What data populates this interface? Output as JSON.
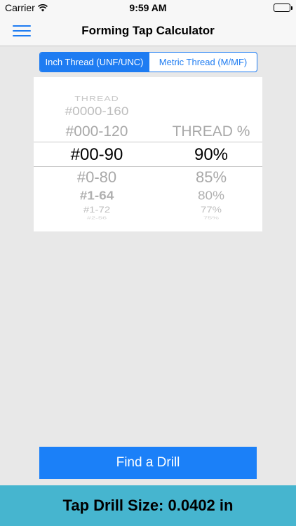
{
  "status_bar": {
    "carrier": "Carrier",
    "time": "9:59 AM"
  },
  "nav": {
    "title": "Forming Tap Calculator",
    "menu_icon": "hamburger-menu-icon"
  },
  "segments": [
    {
      "label": "Inch Thread (UNF/UNC)",
      "selected": true
    },
    {
      "label": "Metric Thread (M/MF)",
      "selected": false
    }
  ],
  "picker": {
    "thread_header": "THREAD",
    "percent_header": "THREAD %",
    "threads": [
      "#0000-160",
      "#000-120",
      "#00-90",
      "#0-80",
      "#1-64",
      "#1-72",
      "#2-56"
    ],
    "selected_thread": "#00-90",
    "percents": [
      "90%",
      "85%",
      "80%",
      "77%",
      "75%"
    ],
    "selected_percent": "90%"
  },
  "find_button": {
    "label": "Find a Drill"
  },
  "result": {
    "text": "Tap Drill Size: 0.0402 in"
  },
  "colors": {
    "accent": "#1e7cf2",
    "button": "#1b80f8",
    "result_bar": "#46b5cf",
    "background": "#e8e8e8"
  }
}
